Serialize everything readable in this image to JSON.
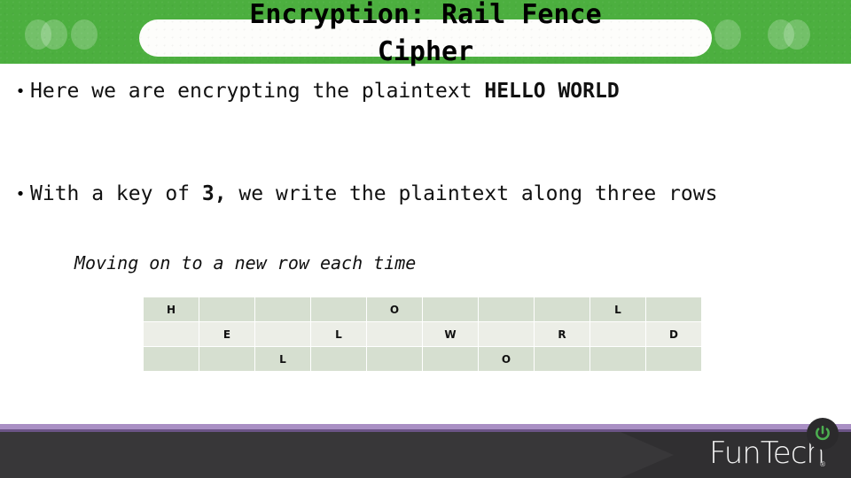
{
  "slide": {
    "title": "Encryption: Rail Fence Cipher",
    "title_line1": "Encryption: Rail Fence",
    "title_line2": "Cipher",
    "header_color": "#4caf3f",
    "accent_color": "#a98fc4",
    "footer_color": "#302f31",
    "power_icon_color": "#4caf50"
  },
  "bullets": [
    {
      "pre": "Here we are encrypting the plaintext ",
      "strong": "HELLO WORLD",
      "post": ""
    },
    {
      "pre": "With a key of ",
      "strong": "3,",
      "post": " we write the plaintext along three rows"
    }
  ],
  "subnote": "Moving on to a new row each time",
  "table": {
    "columns": 10,
    "rows": [
      [
        "H",
        "",
        "",
        "",
        "O",
        "",
        "",
        "",
        "L",
        ""
      ],
      [
        "",
        "E",
        "",
        "L",
        "",
        "W",
        "",
        "R",
        "",
        "D"
      ],
      [
        "",
        "",
        "L",
        "",
        "",
        "",
        "O",
        "",
        "",
        ""
      ]
    ],
    "row_style": [
      "dark",
      "light",
      "dark"
    ],
    "cell_color_dark": "#d6dfd0",
    "cell_color_light": "#eceee7"
  },
  "footer": {
    "brand": "FunTech",
    "registered_mark": "®",
    "power_icon": "power-icon"
  }
}
